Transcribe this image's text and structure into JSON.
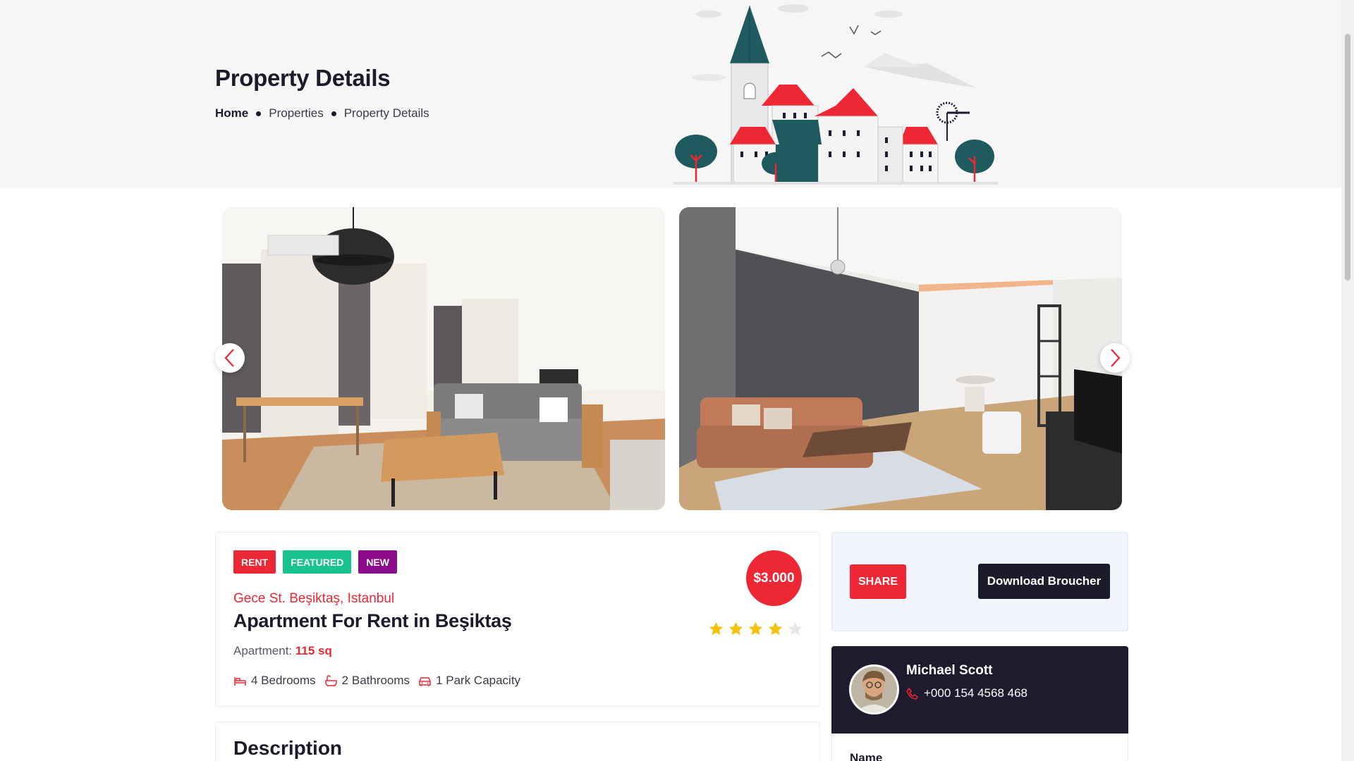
{
  "header": {
    "title": "Property Details",
    "breadcrumb": [
      "Home",
      "Properties",
      "Property Details"
    ]
  },
  "gallery": {
    "prev_label": "previous-slide",
    "next_label": "next-slide"
  },
  "property": {
    "badges": [
      {
        "label": "RENT",
        "color": "#ee2734"
      },
      {
        "label": "FEATURED",
        "color": "#19c38e"
      },
      {
        "label": "NEW",
        "color": "#8b0b8b"
      }
    ],
    "location": "Gece St. Beşiktaş, Istanbul",
    "title": "Apartment For Rent in Beşiktaş",
    "type_label": "Apartment:",
    "area": "115 sq",
    "price": "$3.000",
    "rating": 4,
    "rating_max": 5,
    "features": [
      {
        "icon": "bed-icon",
        "label": "4 Bedrooms"
      },
      {
        "icon": "bath-icon",
        "label": "2 Bathrooms"
      },
      {
        "icon": "car-icon",
        "label": "1 Park Capacity"
      }
    ]
  },
  "description": {
    "title": "Description"
  },
  "actions": {
    "share_label": "SHARE",
    "download_label": "Download Broucher"
  },
  "agent": {
    "name": "Michael Scott",
    "phone": "+000 154 4568 468"
  },
  "form": {
    "name_label": "Name"
  },
  "colors": {
    "accent": "#ee2734",
    "dark": "#1d1a2b",
    "teal": "#1f5a5e"
  }
}
